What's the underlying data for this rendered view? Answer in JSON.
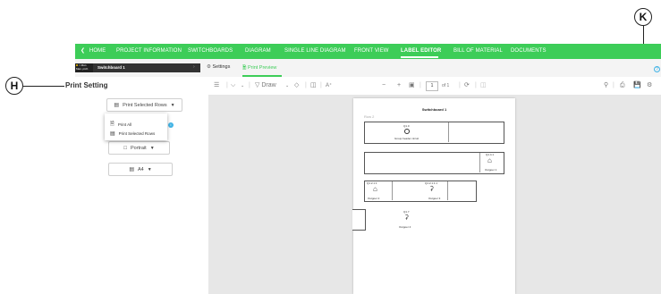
{
  "callouts": {
    "h": "H",
    "k": "K"
  },
  "nav": {
    "home": "HOME",
    "items": [
      "PROJECT INFORMATION",
      "SWITCHBOARDS",
      "DIAGRAM",
      "SINGLE LINE DIAGRAM",
      "FRONT VIEW",
      "LABEL EDITOR",
      "BILL OF MATERIAL",
      "DOCUMENTS"
    ],
    "active": "LABEL EDITOR"
  },
  "breadcrumb": {
    "badge_line1": "> Mon",
    "badge_line2": "Man. prch",
    "switchboard": "Switchboard 1"
  },
  "tabs": {
    "settings": "Settings",
    "print_preview": "Print Preview"
  },
  "left_panel": {
    "title": "Print Setting",
    "print_rows_button": "Print Selected Rows",
    "menu": {
      "print_all": "Print All",
      "print_selected": "Print Selected Rows"
    },
    "orientation_button": "Portrait",
    "paper_button": "A4"
  },
  "toolbar": {
    "draw": "Draw",
    "page_current": "1",
    "page_of": "of 1"
  },
  "preview": {
    "title": "Switchboard 1",
    "row_label": "Row 2",
    "labels": {
      "q1": {
        "code": "Q1.0",
        "name": "Group header circuit"
      },
      "q2": {
        "code": "Q1.4.1",
        "name": "Outgoer 1"
      },
      "q3": {
        "code": "Q1.2.1.1",
        "name": "Outgoer 2"
      },
      "q4": {
        "code": "Q1.2.1.1.1",
        "name": "Outgoer 3"
      },
      "q5": {
        "code": "Q1.7",
        "name": "Outgoer 4"
      }
    }
  },
  "colors": {
    "brand_green": "#3dcd58",
    "help_blue": "#42b4e6"
  }
}
